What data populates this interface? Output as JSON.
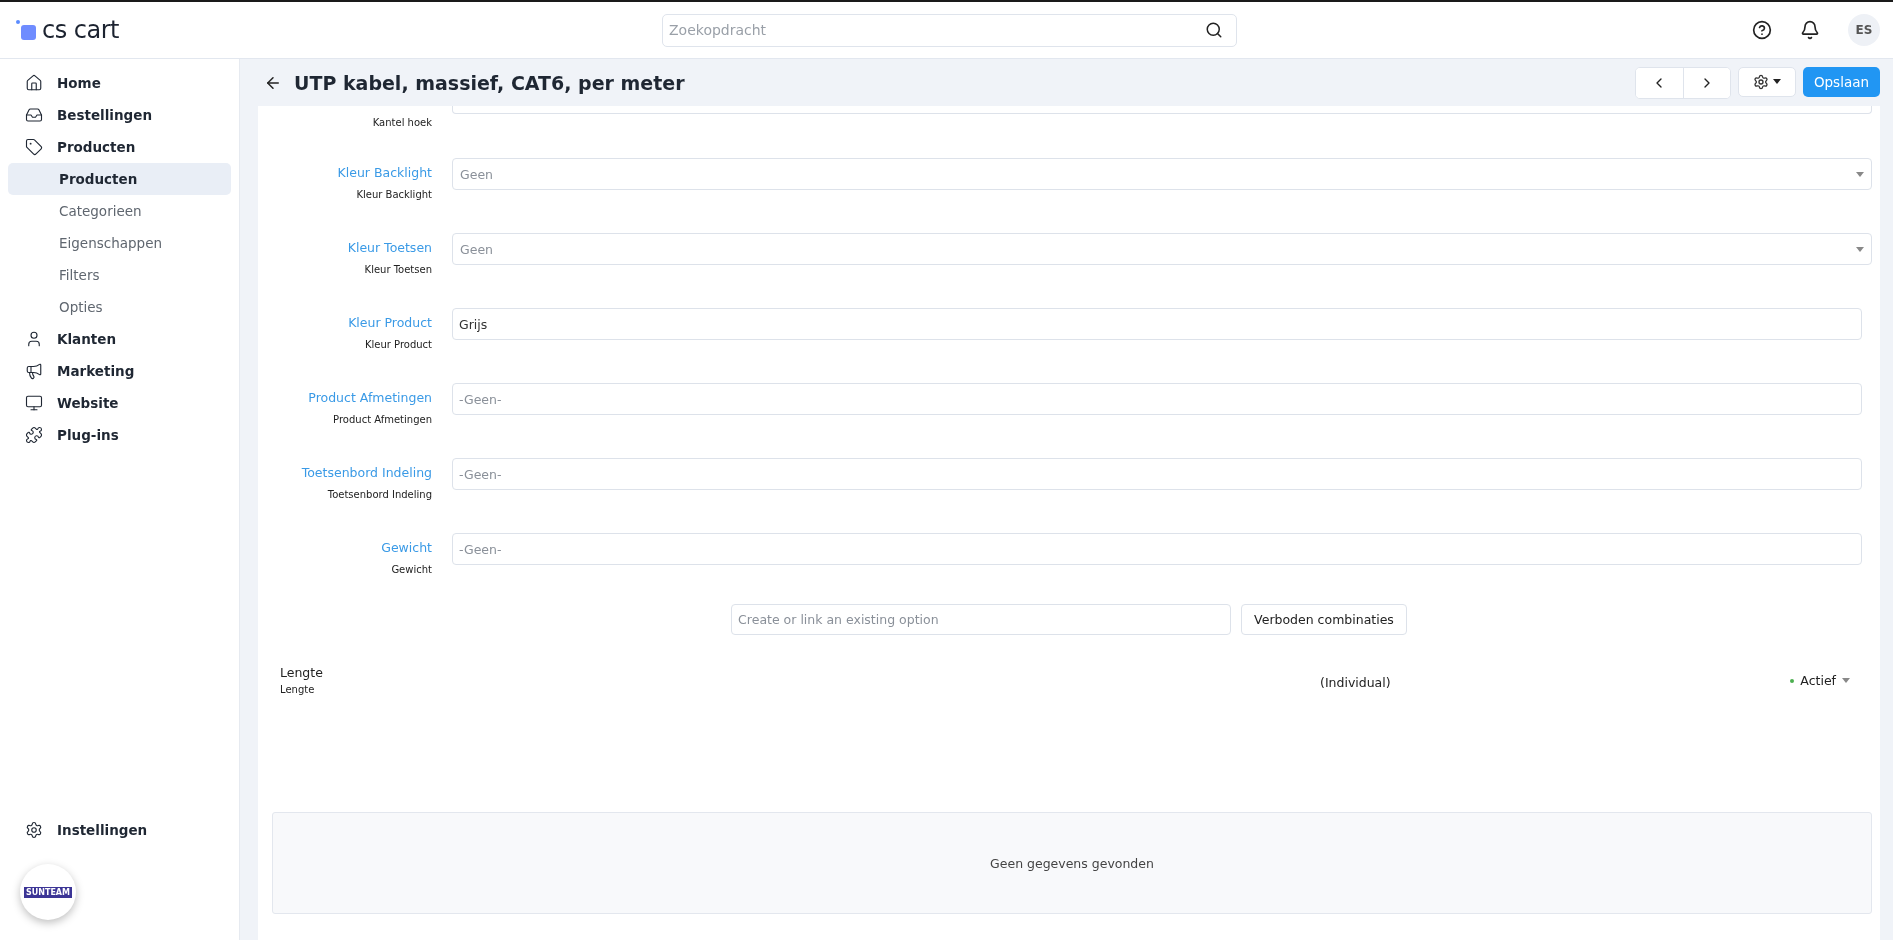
{
  "header": {
    "logo": "cs cart",
    "search": {
      "placeholder": "Zoekopdracht"
    },
    "avatar": "ES"
  },
  "sidebar": {
    "items": [
      {
        "label": "Home",
        "selected": false
      },
      {
        "label": "Bestellingen",
        "selected": false
      },
      {
        "label": "Producten",
        "selected": false,
        "expanded": true,
        "children": [
          {
            "label": "Producten",
            "selected": true
          },
          {
            "label": "Categorieen",
            "selected": false
          },
          {
            "label": "Eigenschappen",
            "selected": false
          },
          {
            "label": "Filters",
            "selected": false
          },
          {
            "label": "Opties",
            "selected": false
          }
        ]
      },
      {
        "label": "Klanten",
        "selected": false
      },
      {
        "label": "Marketing",
        "selected": false
      },
      {
        "label": "Website",
        "selected": false
      },
      {
        "label": "Plug-ins",
        "selected": false
      }
    ],
    "settings": "Instellingen",
    "store_logo": "SUNTEAM"
  },
  "page": {
    "title": "UTP kabel, massief, CAT6, per meter",
    "save_button": "Opslaan"
  },
  "fields": [
    {
      "kind": "select",
      "cut": true,
      "sublabel": "Kantel hoek"
    },
    {
      "kind": "select",
      "label": "Kleur Backlight",
      "sublabel": "Kleur Backlight",
      "value": "Geen"
    },
    {
      "kind": "select",
      "label": "Kleur Toetsen",
      "sublabel": "Kleur Toetsen",
      "value": "Geen"
    },
    {
      "kind": "input",
      "label": "Kleur Product",
      "sublabel": "Kleur Product",
      "value": "Grijs"
    },
    {
      "kind": "input",
      "label": "Product Afmetingen",
      "sublabel": "Product Afmetingen",
      "placeholder": "-Geen-"
    },
    {
      "kind": "input",
      "label": "Toetsenbord Indeling",
      "sublabel": "Toetsenbord Indeling",
      "placeholder": "-Geen-"
    },
    {
      "kind": "input",
      "label": "Gewicht",
      "sublabel": "Gewicht",
      "placeholder": "-Geen-"
    }
  ],
  "options": {
    "search": {
      "placeholder": "Create or link an existing option"
    },
    "button": "Verboden combinaties",
    "rows": [
      {
        "name": "Lengte",
        "sublabel": "Lengte",
        "type": "(Individual)",
        "status": "Actief",
        "active": true
      }
    ],
    "empty_message": "Geen gegevens gevonden"
  }
}
